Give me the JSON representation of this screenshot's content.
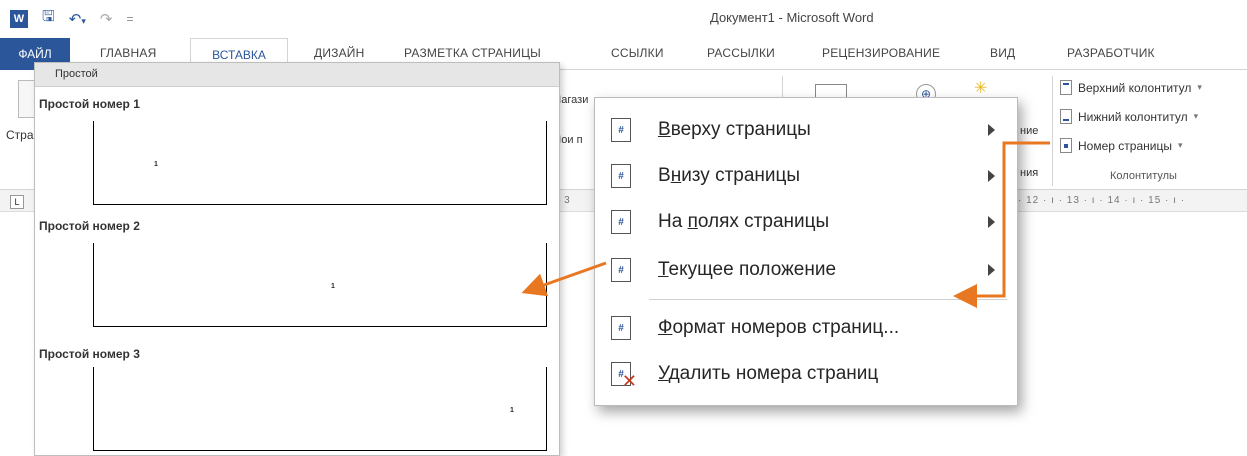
{
  "window": {
    "title": "Документ1 - Microsoft Word"
  },
  "qat": {
    "logo": "W",
    "save": "🖫",
    "undo": "↶",
    "undo_arrow": "▾",
    "redo": "↷",
    "customize": "="
  },
  "tabs": [
    {
      "label": "ФАЙЛ"
    },
    {
      "label": "ГЛАВНАЯ"
    },
    {
      "label": "ВСТАВКА"
    },
    {
      "label": "ДИЗАЙН"
    },
    {
      "label": "РАЗМЕТКА СТРАНИЦЫ"
    },
    {
      "label": "ССЫЛКИ"
    },
    {
      "label": "РАССЫЛКИ"
    },
    {
      "label": "РЕЦЕНЗИРОВАНИЕ"
    },
    {
      "label": "ВИД"
    },
    {
      "label": "РАЗРАБОТЧИК"
    }
  ],
  "ribbon": {
    "frag_stra": "Стра",
    "frag_magaz": "Магази",
    "frag_moi": "Мои п",
    "frag_wiki": "W",
    "frag_nie": "ние",
    "frag_niya": "ния",
    "header_footer": {
      "header": "Верхний колонтитул",
      "footer": "Нижний колонтитул",
      "page_number": "Номер страницы",
      "dropdown_caret": "▾",
      "group_label": "Колонтитулы"
    }
  },
  "ruler": {
    "corner": "L",
    "left_num": "· 3",
    "right_nums": "· 12 · ı · 13 · ı · 14 · ı · 15 · ı ·"
  },
  "gallery": {
    "header": "Простой",
    "items": [
      {
        "title": "Простой номер 1",
        "page_num": "1"
      },
      {
        "title": "Простой номер 2",
        "page_num": "1"
      },
      {
        "title": "Простой номер 3",
        "page_num": "1"
      }
    ]
  },
  "menu": {
    "items": [
      {
        "pre": "",
        "accel": "В",
        "post": "верху страницы",
        "icon": "#",
        "has_arrow": true
      },
      {
        "pre": "В",
        "accel": "н",
        "post": "изу страницы",
        "icon": "#",
        "has_arrow": true
      },
      {
        "pre": "На ",
        "accel": "п",
        "post": "олях страницы",
        "icon": "#",
        "has_arrow": true
      },
      {
        "pre": "",
        "accel": "Т",
        "post": "екущее положение",
        "icon": "#",
        "has_arrow": true
      },
      {
        "pre": "",
        "accel": "Ф",
        "post": "ормат номеров страниц...",
        "icon": "#",
        "has_arrow": false
      },
      {
        "pre": "",
        "accel": "У",
        "post": "далить номера страниц",
        "icon": "#",
        "has_arrow": false
      }
    ],
    "delete_mark": "✕"
  },
  "colors": {
    "word_blue": "#2b579a",
    "callout_orange": "#e87722"
  }
}
